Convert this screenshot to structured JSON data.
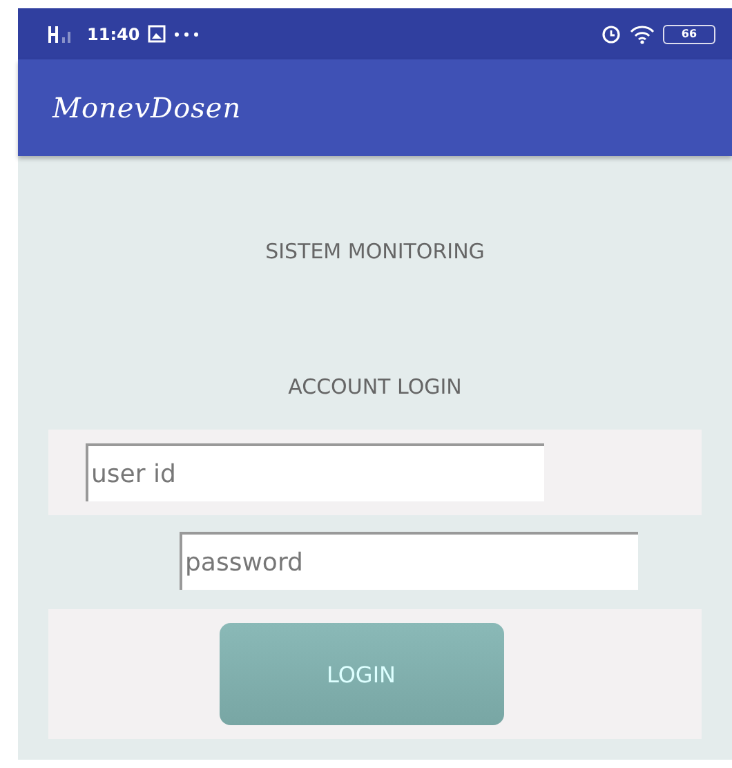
{
  "status_bar": {
    "time": "11:40",
    "battery": "66"
  },
  "app_bar": {
    "title": "MonevDosen"
  },
  "heading": "SISTEM MONITORING",
  "subheading": "ACCOUNT LOGIN",
  "fields": [
    {
      "placeholder": "user id"
    },
    {
      "placeholder": "password"
    }
  ],
  "button": "LOGIN"
}
